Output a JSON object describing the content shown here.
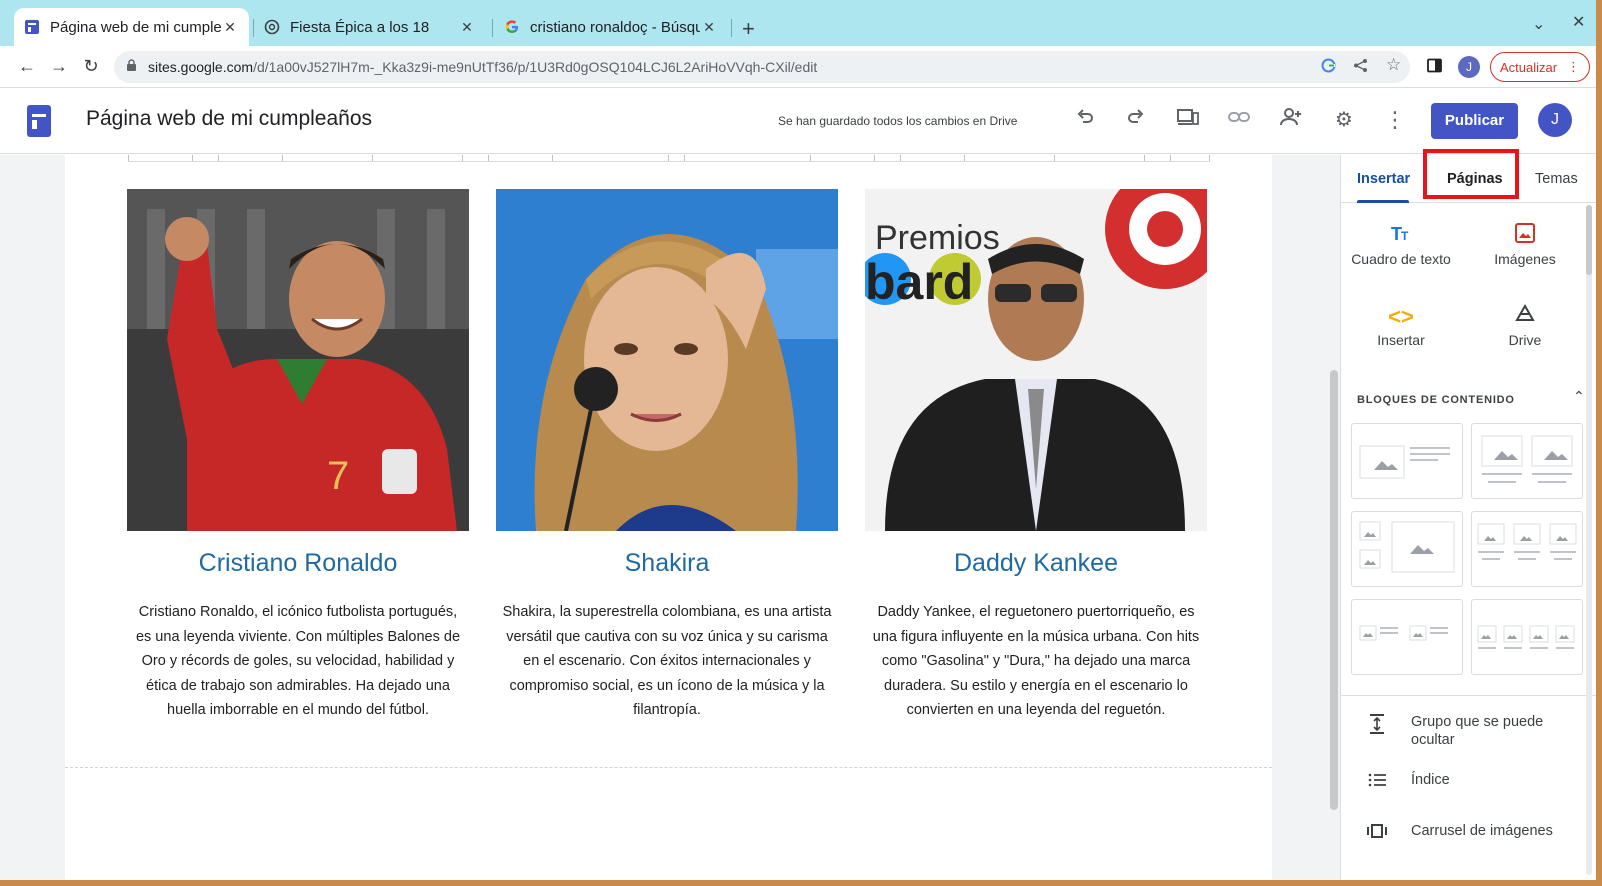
{
  "browser": {
    "tabs": [
      {
        "title": "Página web de mi cumpleaños",
        "icon": "google-sites-icon",
        "active": true
      },
      {
        "title": "Fiesta Épica a los 18",
        "icon": "chatgpt-icon",
        "active": false
      },
      {
        "title": "cristiano ronaldoç - Búsqueda de Google",
        "icon": "google-icon",
        "active": false
      }
    ],
    "new_tab_label": "+",
    "url_host": "sites.google.com",
    "url_path": "/d/1a00vJ527lH7m-_Kka3z9i-me9nUtTf36/p/1U3Rd0gOSQ104LCJ6L2AriHoVVqh-CXil/edit",
    "profile_initial": "J",
    "update_label": "Actualizar"
  },
  "sites_header": {
    "title": "Página web de mi cumpleaños",
    "saved_message": "Se han guardado todos los cambios en Drive",
    "publish_label": "Publicar",
    "user_initial": "J"
  },
  "cards": [
    {
      "name": "Cristiano Ronaldo",
      "text": "Cristiano Ronaldo, el icónico futbolista portugués, es una leyenda viviente. Con múltiples Balones de Oro y récords de goles, su velocidad, habilidad y ética de trabajo son admirables. Ha dejado una huella imborrable en el mundo del fútbol.",
      "photo_color": "#c62828"
    },
    {
      "name": "Shakira",
      "text": "Shakira, la superestrella colombiana, es una artista versátil que cautiva con su voz única y su carisma en el escenario. Con éxitos internacionales y compromiso social, es un ícono de la música y la filantropía.",
      "photo_color": "#2f7fd1"
    },
    {
      "name": "Daddy Kankee",
      "text": "Daddy Yankee, el reguetonero puertorriqueño, es una figura influyente en la música urbana. Con hits como \"Gasolina\" y \"Dura,\" ha dejado una marca duradera. Su estilo y energía en el escenario lo convierten en una leyenda del reguetón.",
      "photo_color": "#3a3a3a"
    }
  ],
  "sidebar": {
    "tabs": [
      "Insertar",
      "Páginas",
      "Temas"
    ],
    "insert_items": [
      {
        "label": "Cuadro de texto",
        "icon": "text-box-icon"
      },
      {
        "label": "Imágenes",
        "icon": "image-icon"
      },
      {
        "label": "Insertar",
        "icon": "embed-icon"
      },
      {
        "label": "Drive",
        "icon": "drive-icon"
      }
    ],
    "content_blocks_label": "BLOQUES DE CONTENIDO",
    "list_items": [
      {
        "label": "Grupo que se puede ocultar",
        "icon": "collapsible-group-icon"
      },
      {
        "label": "Índice",
        "icon": "table-of-contents-icon"
      },
      {
        "label": "Carrusel de imágenes",
        "icon": "image-carousel-icon"
      }
    ]
  },
  "colors": {
    "accent": "#4355c4",
    "tab_strip": "#aee6ef",
    "highlight": "#e8141b",
    "card_title": "#1e6aa3"
  }
}
